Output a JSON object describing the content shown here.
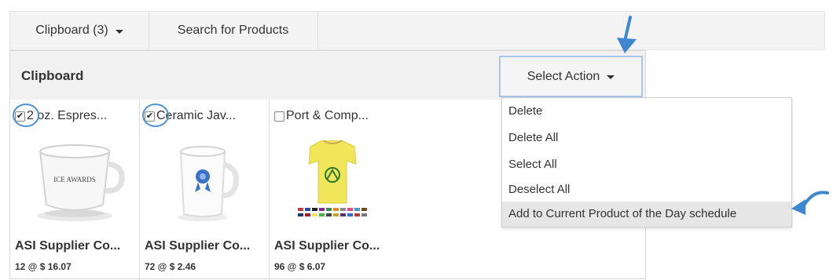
{
  "tabs": [
    {
      "label": "Clipboard (3)"
    },
    {
      "label": "Search for Products"
    }
  ],
  "panel": {
    "title": "Clipboard",
    "action_button": "Select Action"
  },
  "products": [
    {
      "name": "2 oz. Espres...",
      "supplier": "ASI Supplier Co...",
      "price": "12 @ $ 16.07",
      "checked": true,
      "image_text": "ICE AWARDS"
    },
    {
      "name": "Ceramic Jav...",
      "supplier": "ASI Supplier Co...",
      "price": "72 @ $ 2.46",
      "checked": true
    },
    {
      "name": "Port & Comp...",
      "supplier": "ASI Supplier Co...",
      "price": "96 @ $ 6.07",
      "checked": false
    }
  ],
  "menu": {
    "items": [
      "Delete",
      "Delete All",
      "Select All",
      "Deselect All",
      "Add to Current Product of the Day schedule"
    ],
    "highlighted_index": 4
  },
  "colors": {
    "annotation": "#3f87cf",
    "header_bg": "#f1f1f1",
    "menu_highlight": "#e6e6e6"
  }
}
